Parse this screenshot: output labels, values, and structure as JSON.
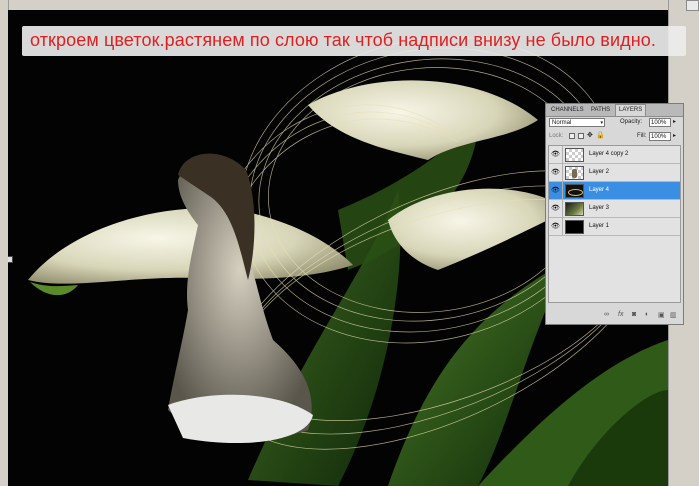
{
  "caption": "откроем цветок.растянем по слою так чтоб надписи внизу не было видно.",
  "colors": {
    "caption_text": "#e02020",
    "selected_layer": "#3b8fe3",
    "canvas_bg": "#030303"
  },
  "layers_panel": {
    "tabs": [
      {
        "label": "CHANNELS",
        "active": false
      },
      {
        "label": "PATHS",
        "active": false
      },
      {
        "label": "LAYERS",
        "active": true
      }
    ],
    "blend_mode": "Normal",
    "opacity_label": "Opacity:",
    "opacity_value": "100%",
    "lock_label": "Lock:",
    "fill_label": "Fill:",
    "fill_value": "100%",
    "layers": [
      {
        "name": "Layer 4 copy 2",
        "visible": true,
        "selected": false,
        "thumb": "transparent-checker"
      },
      {
        "name": "Layer 2",
        "visible": true,
        "selected": false,
        "thumb": "figure"
      },
      {
        "name": "Layer 4",
        "visible": true,
        "selected": true,
        "thumb": "swirl"
      },
      {
        "name": "Layer 3",
        "visible": true,
        "selected": false,
        "thumb": "photo"
      },
      {
        "name": "Layer 1",
        "visible": true,
        "selected": false,
        "thumb": "black"
      }
    ],
    "footer_icons": [
      "link-icon",
      "fx-icon",
      "mask-icon",
      "adjustment-icon",
      "new-layer-icon",
      "trash-icon"
    ]
  }
}
